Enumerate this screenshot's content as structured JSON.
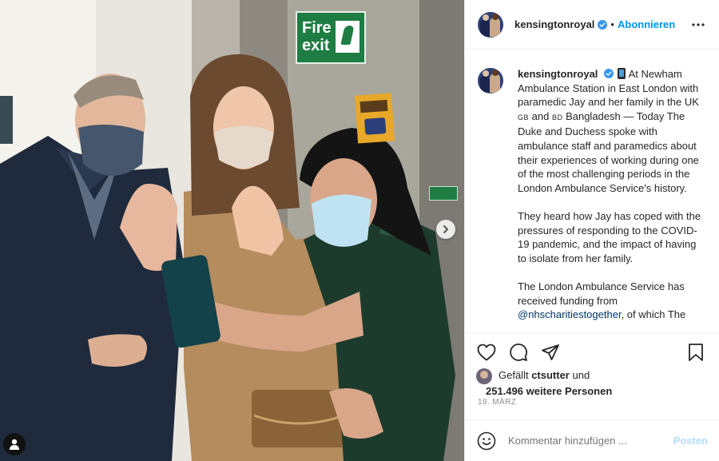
{
  "header": {
    "username": "kensingtonroyal",
    "separator": "•",
    "follow_label": "Abonnieren"
  },
  "photo": {
    "fire_sign_line1": "Fire",
    "fire_sign_line2": "exit"
  },
  "caption": {
    "username": "kensingtonroyal",
    "p1_a": "At Newham Ambulance Station in East London with paramedic Jay and her family in the UK ",
    "p1_flag_gb": "GB",
    "p1_b": " and ",
    "p1_flag_bd": "BD",
    "p1_c": " Bangladesh — Today The Duke and Duchess spoke with ambulance staff and paramedics about their experiences of working during one of the most challenging periods in the London Ambulance Service's history.",
    "p2": "They heard how Jay has coped with the pressures of responding to the COVID-19 pandemic, and the impact of having to isolate from her family.",
    "p3_a": "The London Ambulance Service has received funding from ",
    "p3_mention": "@nhscharitiestogether",
    "p3_b": ", of which The"
  },
  "likes": {
    "prefix": "Gefällt ",
    "user": "ctsutter",
    "suffix": " und",
    "others": "251.496 weitere Personen"
  },
  "date": "18. MÄRZ",
  "comment": {
    "placeholder": "Kommentar hinzufügen ...",
    "post_label": "Posten"
  },
  "colors": {
    "accent": "#0095f6",
    "post_disabled": "#b2dffc",
    "mention": "#00376b",
    "muted": "#8e8e8e"
  }
}
